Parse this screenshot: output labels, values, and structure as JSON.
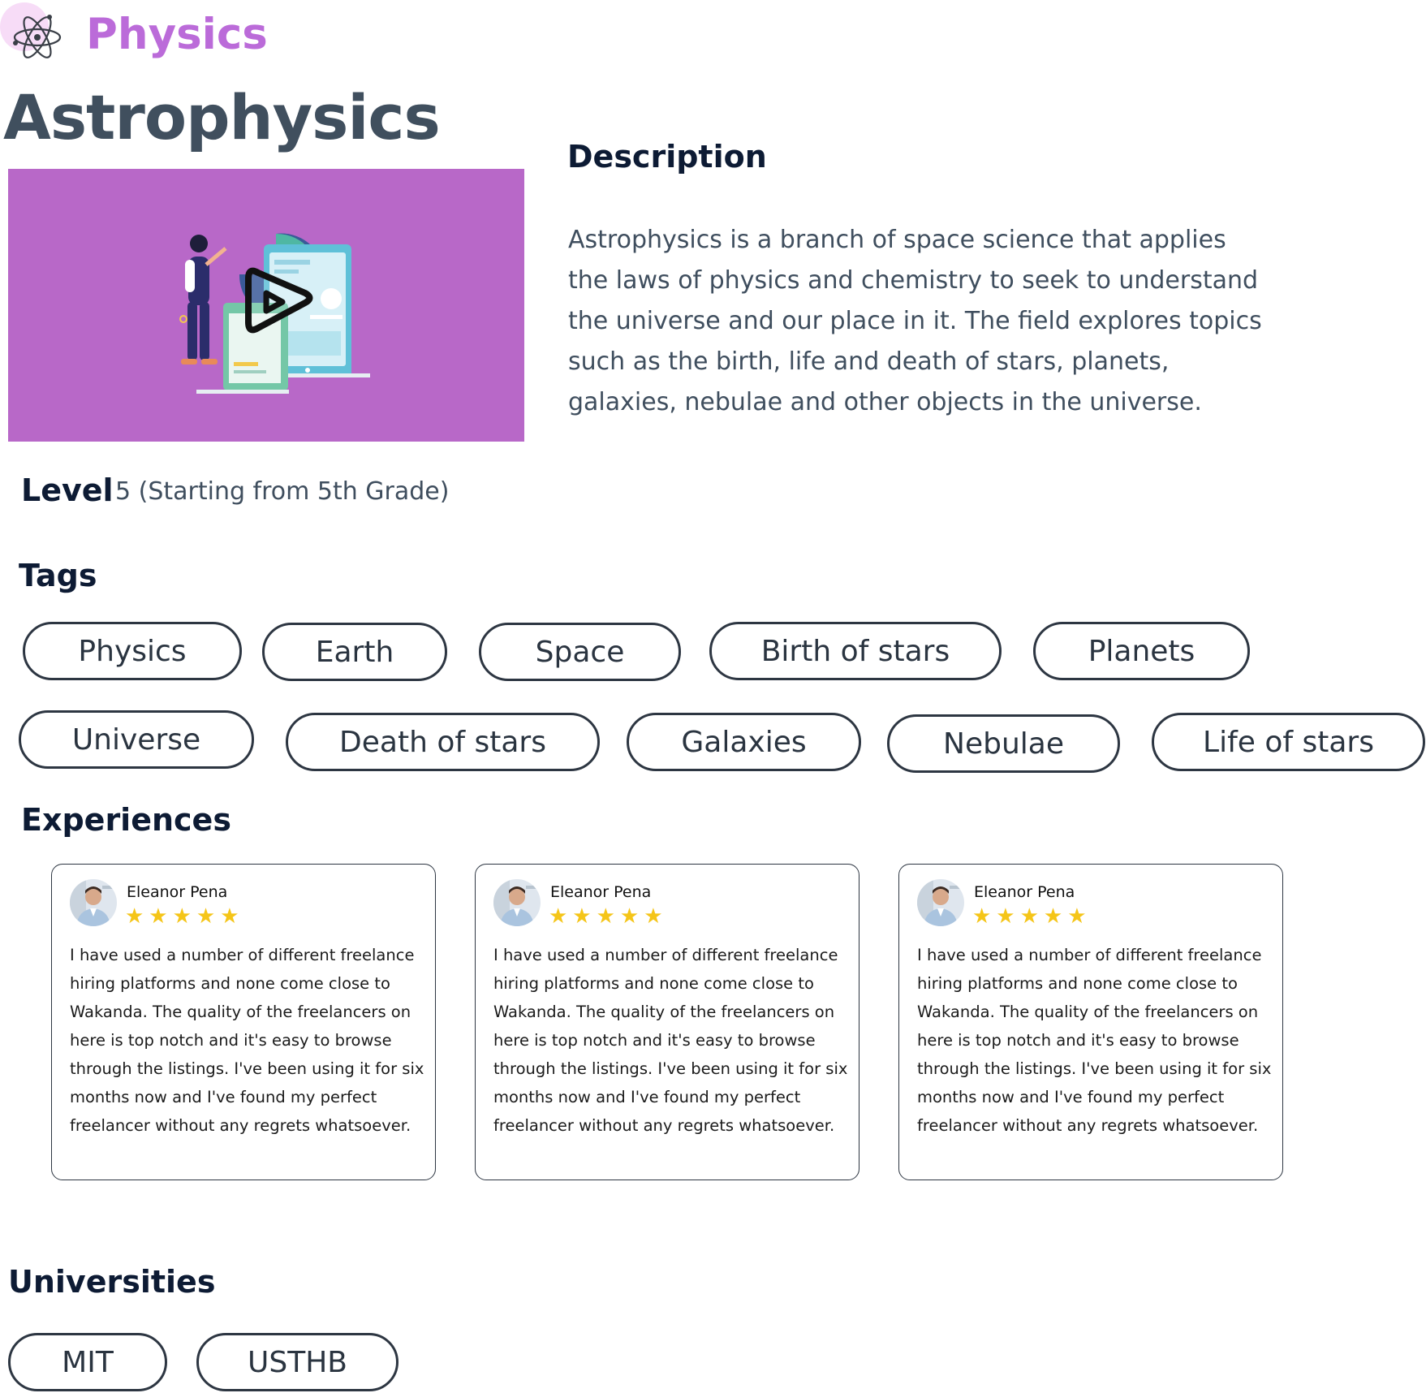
{
  "brand": {
    "name": "Physics",
    "icon": "atom-icon",
    "color": "#bb6bd9"
  },
  "course": {
    "title": "Astrophysics",
    "video": {
      "icon": "play-icon",
      "background": "#b868c8"
    }
  },
  "description": {
    "heading": "Description",
    "text": "Astrophysics is a branch of space science that applies the laws of physics and chemistry to seek to understand the universe and our place in it. The field explores topics such as the birth, life and death of stars, planets, galaxies, nebulae and other objects in the universe."
  },
  "level": {
    "label": "Level",
    "value": "5 (Starting from 5th Grade)"
  },
  "tags": {
    "heading": "Tags",
    "items": [
      "Physics",
      "Earth",
      "Space",
      "Birth of stars",
      "Planets",
      "Universe",
      "Death of stars",
      "Galaxies",
      "Nebulae",
      "Life of stars"
    ]
  },
  "experiences": {
    "heading": "Experiences",
    "reviews": [
      {
        "name": "Eleanor Pena",
        "stars": "★★★★★",
        "rating": 5,
        "text": "I have used a number of different freelance hiring platforms and none come close to Wakanda. The quality of the freelancers on here is top notch and it's easy to browse through the listings. I've been using it for six months now and I've found my perfect freelancer without any regrets whatsoever."
      },
      {
        "name": "Eleanor Pena",
        "stars": "★★★★★",
        "rating": 5,
        "text": "I have used a number of different freelance hiring platforms and none come close to Wakanda. The quality of the freelancers on here is top notch and it's easy to browse through the listings. I've been using it for six months now and I've found my perfect freelancer without any regrets whatsoever."
      },
      {
        "name": "Eleanor Pena",
        "stars": "★★★★★",
        "rating": 5,
        "text": "I have used a number of different freelance hiring platforms and none come close to Wakanda. The quality of the freelancers on here is top notch and it's easy to browse through the listings. I've been using it for six months now and I've found my perfect freelancer without any regrets whatsoever."
      }
    ]
  },
  "universities": {
    "heading": "Universities",
    "items": [
      "MIT",
      "USTHB"
    ]
  },
  "colors": {
    "heading": "#0d1b34",
    "title": "#404f5e",
    "body": "#3f4e5e",
    "pill_border": "#2d3642",
    "star": "#f5c518"
  }
}
